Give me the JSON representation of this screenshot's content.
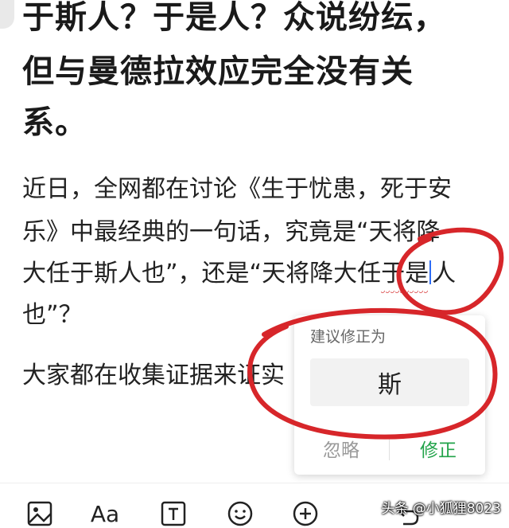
{
  "headline": {
    "lines": [
      "于斯人？于是人？众说纷纭，",
      "但与曼德拉效应完全没有关",
      "系。"
    ]
  },
  "body": {
    "para1": {
      "line1": "近日，全网都在讨论《生于忧患，死于安",
      "line2": "乐》中最经典的一句话，究竟是“天将降",
      "line3_before": "大任于斯人也”，还是“天将降大任",
      "line3_flag": "于是",
      "line3_after": "人",
      "line4": "也”？"
    },
    "para2": {
      "line1": "大家都在收集证据来证实"
    }
  },
  "popup": {
    "title": "建议修正为",
    "suggestion": "斯",
    "ignore_label": "忽略",
    "fix_label": "修正"
  },
  "toolbar": {
    "icons": [
      "image-icon",
      "font-icon",
      "text-box-icon",
      "emoji-icon",
      "add-icon",
      "undo-icon"
    ],
    "font_label": "Aa"
  },
  "watermark": "头条 @小狐狸8023",
  "colors": {
    "annotation_red": "#d7262a",
    "fix_green": "#22a34a",
    "cursor_blue": "#2e6df6"
  }
}
